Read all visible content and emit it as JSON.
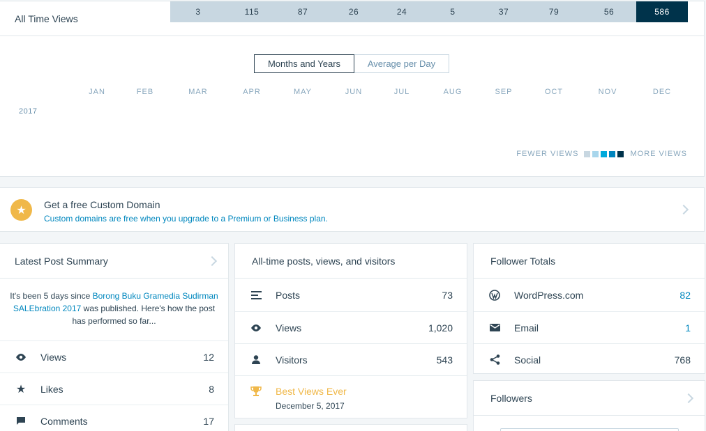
{
  "views_card": {
    "title": "All Time Views",
    "toggle": [
      "Months and Years",
      "Average per Day"
    ],
    "months": [
      "JAN",
      "FEB",
      "MAR",
      "APR",
      "MAY",
      "JUN",
      "JUL",
      "AUG",
      "SEP",
      "OCT",
      "NOV",
      "DEC"
    ],
    "year": "2017",
    "values": [
      "",
      "",
      "3",
      "115",
      "87",
      "26",
      "24",
      "5",
      "37",
      "79",
      "56",
      "586"
    ],
    "legend_fewer": "FEWER VIEWS",
    "legend_more": "MORE VIEWS",
    "legend_colors": [
      "#c8d7e1",
      "#a8d6ec",
      "#00aadc",
      "#0085be",
      "#00334b"
    ]
  },
  "domain_card": {
    "title": "Get a free Custom Domain",
    "subtitle": "Custom domains are free when you upgrade to a Premium or Business plan.",
    "icon": "star-icon"
  },
  "latest_post": {
    "title": "Latest Post Summary",
    "summary_pre": "It's been 5 days since ",
    "summary_link": "Borong Buku Gramedia Sudirman SALEbration 2017",
    "summary_post": " was published. Here's how the post has performed so far...",
    "rows": [
      {
        "label": "Views",
        "value": "12",
        "icon": "eye-icon"
      },
      {
        "label": "Likes",
        "value": "8",
        "icon": "star-icon"
      },
      {
        "label": "Comments",
        "value": "17",
        "icon": "comment-icon"
      }
    ]
  },
  "alltime": {
    "title": "All-time posts, views, and visitors",
    "rows": [
      {
        "label": "Posts",
        "value": "73",
        "icon": "posts-icon"
      },
      {
        "label": "Views",
        "value": "1,020",
        "icon": "eye-icon"
      },
      {
        "label": "Visitors",
        "value": "543",
        "icon": "person-icon"
      }
    ],
    "best_title": "Best Views Ever",
    "best_date": "December 5, 2017"
  },
  "follower_totals": {
    "title": "Follower Totals",
    "rows": [
      {
        "label": "WordPress.com",
        "value": "82",
        "icon": "wordpress-icon"
      },
      {
        "label": "Email",
        "value": "1",
        "icon": "mail-icon"
      },
      {
        "label": "Social",
        "value": "768",
        "icon": "share-icon"
      }
    ]
  },
  "followers": {
    "title": "Followers"
  }
}
